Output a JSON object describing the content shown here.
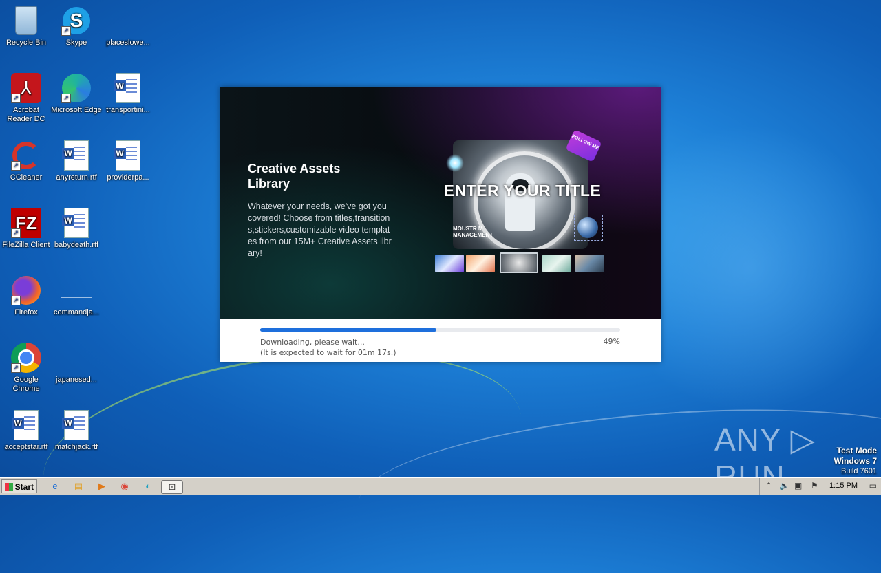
{
  "desktop": {
    "icons": [
      {
        "label": "Recycle Bin"
      },
      {
        "label": "Skype"
      },
      {
        "label": "placeslowe..."
      },
      {
        "label": "Acrobat Reader DC"
      },
      {
        "label": "Microsoft Edge"
      },
      {
        "label": "transportini..."
      },
      {
        "label": "CCleaner"
      },
      {
        "label": "anyreturn.rtf"
      },
      {
        "label": "providerpa..."
      },
      {
        "label": "FileZilla Client"
      },
      {
        "label": "babydeath.rtf"
      },
      {
        "label": "Firefox"
      },
      {
        "label": "commandja..."
      },
      {
        "label": "Google Chrome"
      },
      {
        "label": "japanesed..."
      },
      {
        "label": "acceptstar.rtf"
      },
      {
        "label": "matchjack.rtf"
      }
    ]
  },
  "installer": {
    "title": "Creative Assets Library",
    "description": "Whatever your needs, we've got you covered! Choose from titles,transitions,stickers,customizable video templates from our 15M+ Creative Assets library!",
    "preview": {
      "headline": "ENTER YOUR TITLE",
      "subtext": "MOUSTR M MANAGEMENT",
      "badge": "FOLLOW ME"
    },
    "progress": {
      "value": 0.49,
      "status": "Downloading, please wait...",
      "eta": "(It is expected to wait for 01m 17s.)",
      "percent_label": "49%"
    }
  },
  "watermark": {
    "brand": "ANY ▷ RUN",
    "mode": "Test Mode",
    "os": "Windows 7",
    "build": "Build 7601"
  },
  "taskbar": {
    "start_label": "Start",
    "clock": "1:15 PM"
  }
}
